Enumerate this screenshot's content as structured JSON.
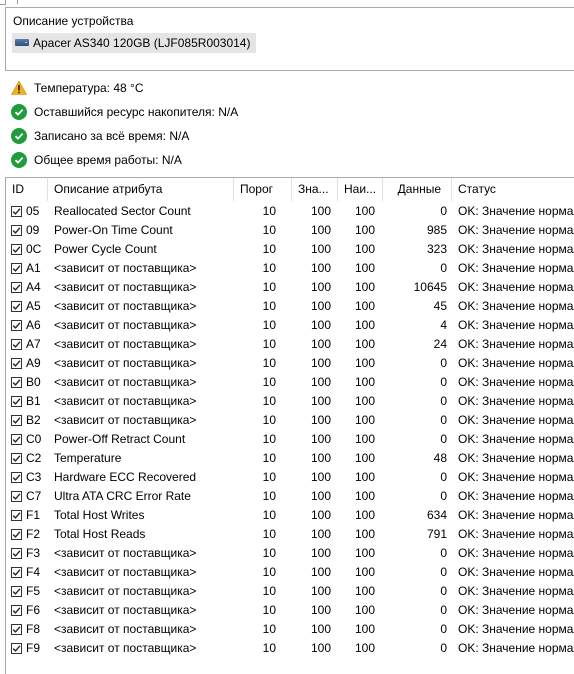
{
  "device_group": {
    "title": "Описание устройства",
    "device_name": "Apacer AS340 120GB (LJF085R003014)"
  },
  "status_lines": [
    {
      "icon": "warning-icon",
      "text": "Температура: 48 °C"
    },
    {
      "icon": "ok-check-icon",
      "text": "Оставшийся ресурс накопителя: N/A"
    },
    {
      "icon": "ok-check-icon",
      "text": "Записано за всё время: N/A"
    },
    {
      "icon": "ok-check-icon",
      "text": "Общее время работы: N/A"
    }
  ],
  "colors": {
    "ok": "#1f9d3a",
    "warning": "#f2b01e",
    "selection": "#e5e5e5"
  },
  "table": {
    "headers": {
      "id": "ID",
      "name": "Описание атрибута",
      "threshold": "Порог",
      "current": "Зна...",
      "worst": "Наи...",
      "data": "Данные",
      "status": "Статус"
    },
    "rows": [
      {
        "id": "05",
        "name": "Reallocated Sector Count",
        "threshold": "10",
        "current": "100",
        "worst": "100",
        "data": "0",
        "status": "OK: Значение нормал"
      },
      {
        "id": "09",
        "name": "Power-On Time Count",
        "threshold": "10",
        "current": "100",
        "worst": "100",
        "data": "985",
        "status": "OK: Значение нормал"
      },
      {
        "id": "0C",
        "name": "Power Cycle Count",
        "threshold": "10",
        "current": "100",
        "worst": "100",
        "data": "323",
        "status": "OK: Значение нормал"
      },
      {
        "id": "A1",
        "name": "<зависит от поставщика>",
        "threshold": "10",
        "current": "100",
        "worst": "100",
        "data": "0",
        "status": "OK: Значение нормал"
      },
      {
        "id": "A4",
        "name": "<зависит от поставщика>",
        "threshold": "10",
        "current": "100",
        "worst": "100",
        "data": "10645",
        "status": "OK: Значение нормал"
      },
      {
        "id": "A5",
        "name": "<зависит от поставщика>",
        "threshold": "10",
        "current": "100",
        "worst": "100",
        "data": "45",
        "status": "OK: Значение нормал"
      },
      {
        "id": "A6",
        "name": "<зависит от поставщика>",
        "threshold": "10",
        "current": "100",
        "worst": "100",
        "data": "4",
        "status": "OK: Значение нормал"
      },
      {
        "id": "A7",
        "name": "<зависит от поставщика>",
        "threshold": "10",
        "current": "100",
        "worst": "100",
        "data": "24",
        "status": "OK: Значение нормал"
      },
      {
        "id": "A9",
        "name": "<зависит от поставщика>",
        "threshold": "10",
        "current": "100",
        "worst": "100",
        "data": "0",
        "status": "OK: Значение нормал"
      },
      {
        "id": "B0",
        "name": "<зависит от поставщика>",
        "threshold": "10",
        "current": "100",
        "worst": "100",
        "data": "0",
        "status": "OK: Значение нормал"
      },
      {
        "id": "B1",
        "name": "<зависит от поставщика>",
        "threshold": "10",
        "current": "100",
        "worst": "100",
        "data": "0",
        "status": "OK: Значение нормал"
      },
      {
        "id": "B2",
        "name": "<зависит от поставщика>",
        "threshold": "10",
        "current": "100",
        "worst": "100",
        "data": "0",
        "status": "OK: Значение нормал"
      },
      {
        "id": "C0",
        "name": "Power-Off Retract Count",
        "threshold": "10",
        "current": "100",
        "worst": "100",
        "data": "0",
        "status": "OK: Значение нормал"
      },
      {
        "id": "C2",
        "name": "Temperature",
        "threshold": "10",
        "current": "100",
        "worst": "100",
        "data": "48",
        "status": "OK: Значение нормал"
      },
      {
        "id": "C3",
        "name": "Hardware ECC Recovered",
        "threshold": "10",
        "current": "100",
        "worst": "100",
        "data": "0",
        "status": "OK: Значение нормал"
      },
      {
        "id": "C7",
        "name": "Ultra ATA CRC Error Rate",
        "threshold": "10",
        "current": "100",
        "worst": "100",
        "data": "0",
        "status": "OK: Значение нормал"
      },
      {
        "id": "F1",
        "name": "Total Host Writes",
        "threshold": "10",
        "current": "100",
        "worst": "100",
        "data": "634",
        "status": "OK: Значение нормал"
      },
      {
        "id": "F2",
        "name": "Total Host Reads",
        "threshold": "10",
        "current": "100",
        "worst": "100",
        "data": "791",
        "status": "OK: Значение нормал"
      },
      {
        "id": "F3",
        "name": "<зависит от поставщика>",
        "threshold": "10",
        "current": "100",
        "worst": "100",
        "data": "0",
        "status": "OK: Значение нормал"
      },
      {
        "id": "F4",
        "name": "<зависит от поставщика>",
        "threshold": "10",
        "current": "100",
        "worst": "100",
        "data": "0",
        "status": "OK: Значение нормал"
      },
      {
        "id": "F5",
        "name": "<зависит от поставщика>",
        "threshold": "10",
        "current": "100",
        "worst": "100",
        "data": "0",
        "status": "OK: Значение нормал"
      },
      {
        "id": "F6",
        "name": "<зависит от поставщика>",
        "threshold": "10",
        "current": "100",
        "worst": "100",
        "data": "0",
        "status": "OK: Значение нормал"
      },
      {
        "id": "F8",
        "name": "<зависит от поставщика>",
        "threshold": "10",
        "current": "100",
        "worst": "100",
        "data": "0",
        "status": "OK: Значение нормал"
      },
      {
        "id": "F9",
        "name": "<зависит от поставщика>",
        "threshold": "10",
        "current": "100",
        "worst": "100",
        "data": "0",
        "status": "OK: Значение нормал"
      }
    ]
  }
}
